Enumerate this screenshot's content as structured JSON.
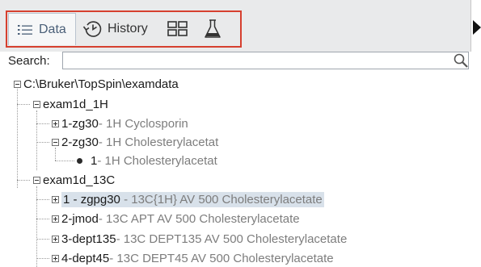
{
  "toolbar": {
    "tabs": [
      {
        "label": "Data",
        "icon": "list-icon",
        "active": true
      },
      {
        "label": "History",
        "icon": "history-icon"
      },
      {
        "label": "",
        "icon": "grid-icon"
      },
      {
        "label": "",
        "icon": "flask-icon"
      }
    ],
    "highlight_color": "#d6402f"
  },
  "search": {
    "label": "Search:",
    "value": "",
    "icon": "search-icon"
  },
  "tree": {
    "root": {
      "label": "C:\\Bruker\\TopSpin\\examdata",
      "expanded": true
    },
    "datasets": [
      {
        "name": "exam1d_1H",
        "expanded": true,
        "experiments": [
          {
            "number": "1",
            "sep": " - ",
            "pulprog": "zg30",
            "desc": " - 1H Cyclosporin",
            "expanded": false
          },
          {
            "number": "2",
            "sep": " - ",
            "pulprog": "zg30",
            "desc": " - 1H Cholesterylacetat",
            "expanded": true,
            "procnos": [
              {
                "number": "1",
                "desc": " - 1H Cholesterylacetat"
              }
            ]
          }
        ]
      },
      {
        "name": "exam1d_13C",
        "expanded": true,
        "experiments": [
          {
            "number": "1",
            "sep": " - ",
            "pulprog": "zgpg30",
            "desc": " - 13C{1H} AV 500 Cholesterylacetate",
            "expanded": false,
            "selected": true
          },
          {
            "number": "2",
            "sep": " - ",
            "pulprog": "jmod",
            "desc": " - 13C APT AV 500 Cholesterylacetate",
            "expanded": false
          },
          {
            "number": "3",
            "sep": " - ",
            "pulprog": "dept135",
            "desc": " - 13C DEPT135 AV 500 Cholesterylacetate",
            "expanded": false
          },
          {
            "number": "4",
            "sep": " - ",
            "pulprog": "dept45",
            "desc": " - 13C DEPT45 AV 500 Cholesterylacetate",
            "expanded": false
          }
        ]
      }
    ]
  }
}
